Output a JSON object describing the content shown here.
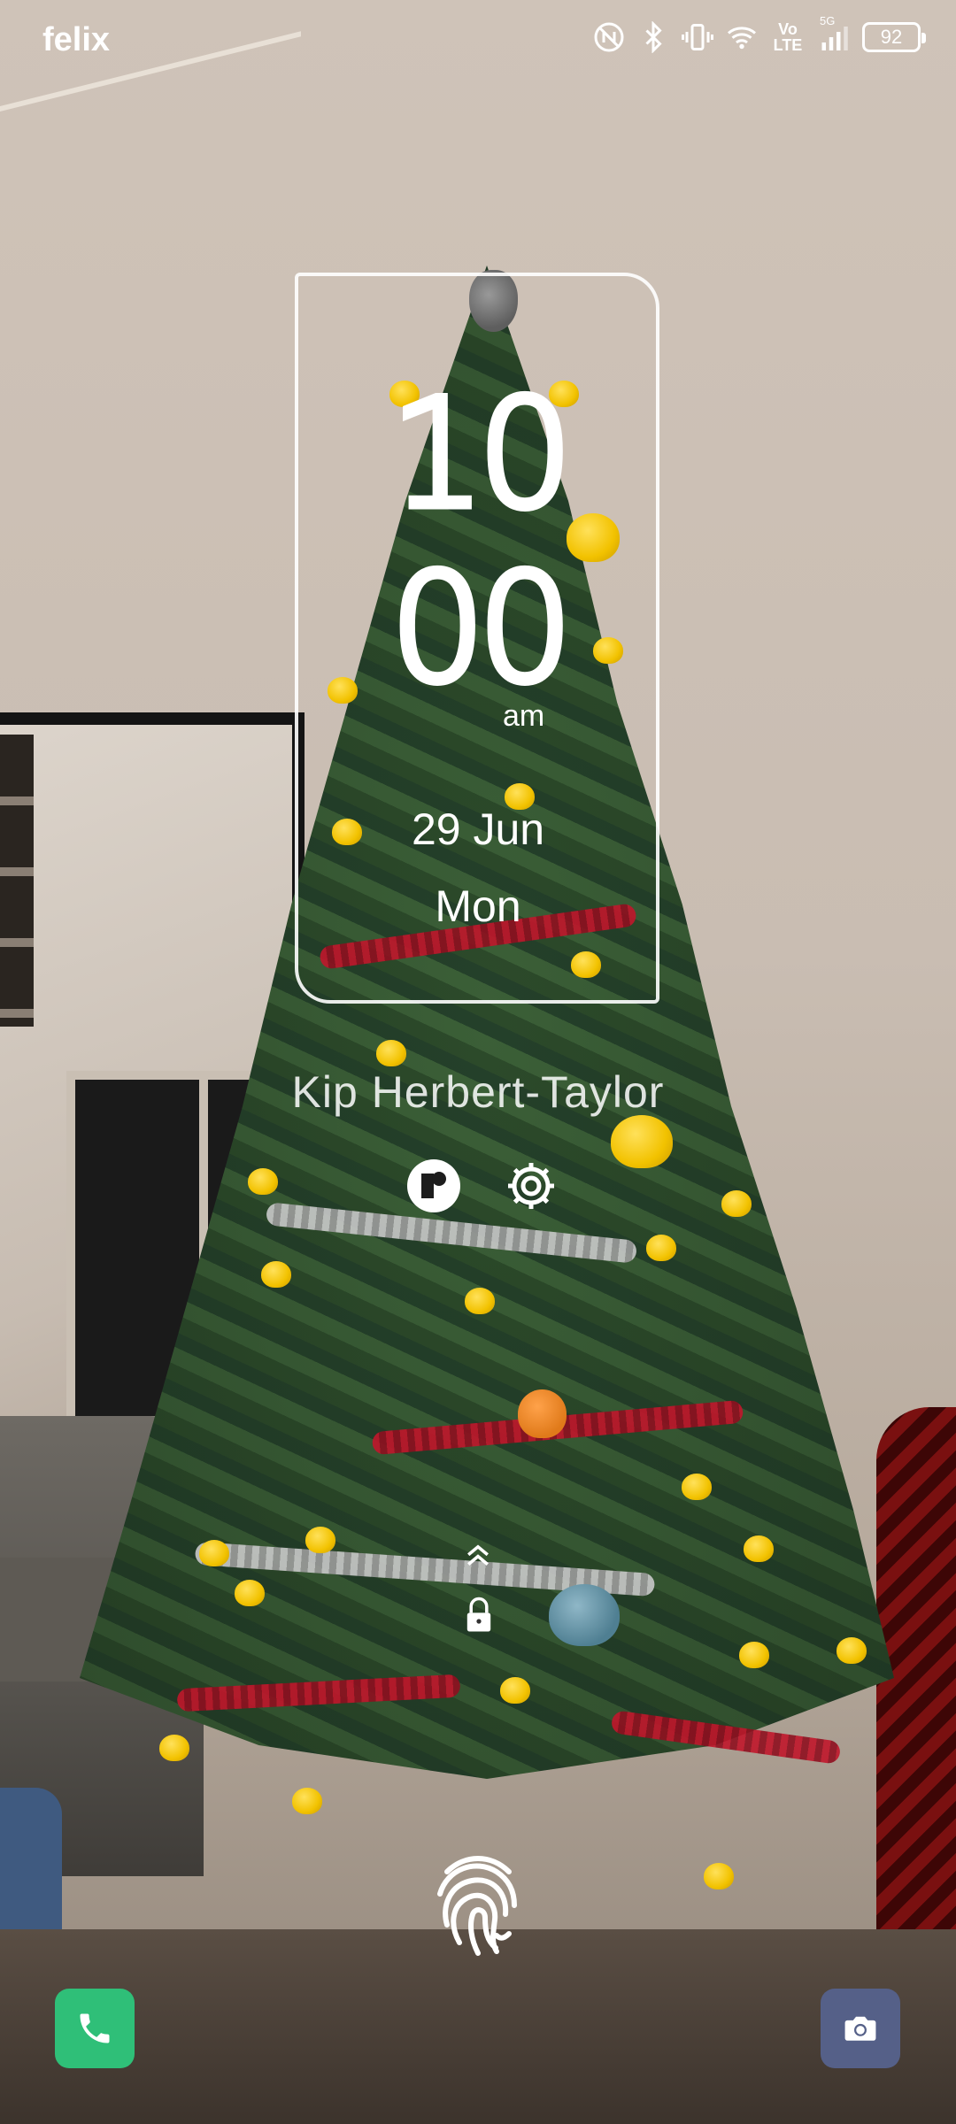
{
  "status_bar": {
    "carrier": "felix",
    "network_top_label": "5G",
    "volte_line1": "Vo",
    "volte_line2": "LTE",
    "battery_level": "92",
    "icons": [
      "nfc-icon",
      "bluetooth-icon",
      "vibrate-icon",
      "wifi-icon",
      "volte-icon",
      "signal-icon",
      "battery-icon"
    ]
  },
  "clock": {
    "hours": "10",
    "minutes": "00",
    "ampm": "am",
    "date": "29 Jun",
    "weekday": "Mon"
  },
  "owner_name": "Kip Herbert-Taylor",
  "shortcuts": [
    "edit-icon",
    "gear-icon"
  ],
  "swipe_hint_icon": "chevron-up-icon",
  "lock_icon": "lock-icon",
  "fingerprint_icon": "fingerprint-icon",
  "bottom_buttons": {
    "left": "phone-icon",
    "right": "camera-icon"
  },
  "colors": {
    "phone_button": "#2fbf78",
    "camera_button": "#556088"
  }
}
